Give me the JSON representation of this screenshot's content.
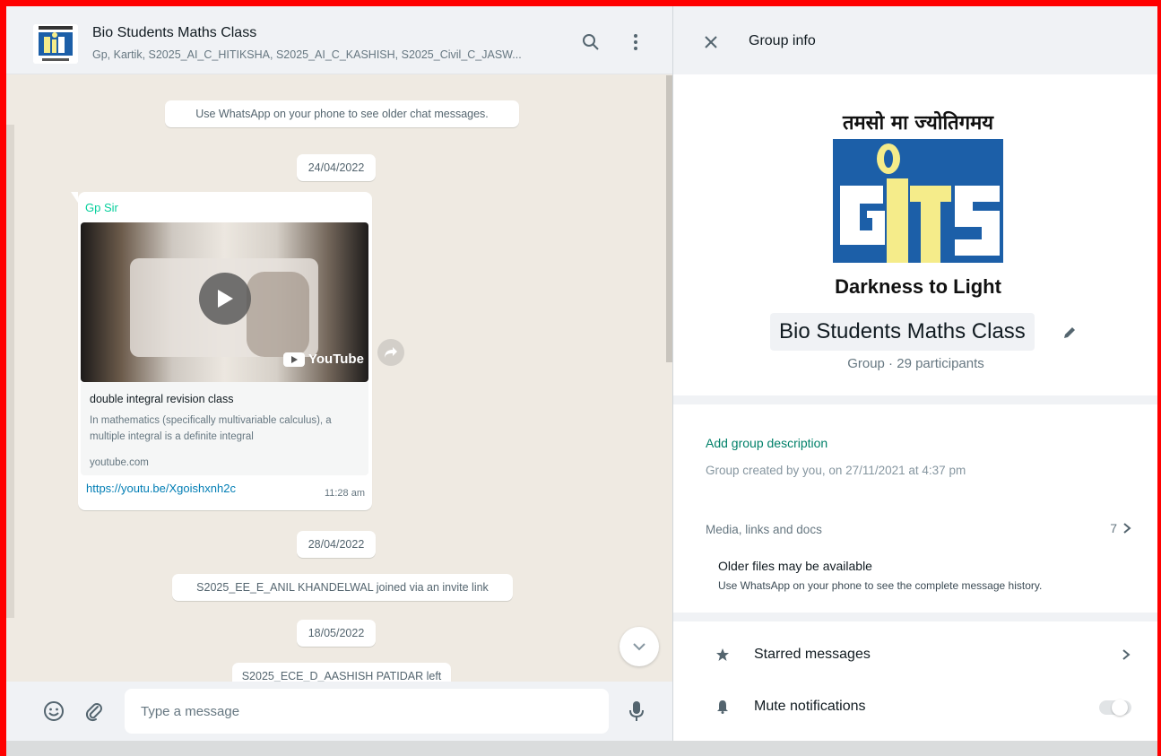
{
  "chat": {
    "title": "Bio Students Maths Class",
    "subtitle": "Gp, Kartik, S2025_AI_C_HITIKSHA, S2025_AI_C_KASHISH, S2025_Civil_C_JASW...",
    "older_notice": "Use WhatsApp on your phone to see older chat messages.",
    "date_1": "24/04/2022",
    "message": {
      "sender": "Gp Sir",
      "thumbnail_brand": "YouTube",
      "preview_title": "double integral revision class",
      "preview_description": "In mathematics (specifically multivariable calculus), a multiple integral is a definite integral",
      "preview_domain": "youtube.com",
      "link": "https://youtu.be/Xgoishxnh2c",
      "time": "11:28 am"
    },
    "date_2": "28/04/2022",
    "event_joined": "S2025_EE_E_ANIL KHANDELWAL joined via an invite link",
    "date_3": "18/05/2022",
    "event_left": "S2025_ECE_D_AASHISH PATIDAR left",
    "composer_placeholder": "Type a message"
  },
  "info": {
    "header_title": "Group info",
    "logo_top_text": "तमसो मा ज्योतिगमय",
    "logo_bottom_text": "Darkness to Light",
    "group_name": "Bio Students Maths Class",
    "group_meta": "Group · 29 participants",
    "add_description": "Add group description",
    "created_text": "Group created by you, on 27/11/2021 at 4:37 pm",
    "media_label": "Media, links and docs",
    "media_count": "7",
    "older_files_title": "Older files may be available",
    "older_files_sub": "Use WhatsApp on your phone to see the complete message history.",
    "starred_label": "Starred messages",
    "mute_label": "Mute notifications",
    "mute_enabled": false
  },
  "colors": {
    "accent_green": "#008069",
    "sender_green": "#06cf9c",
    "link_blue": "#027eb5",
    "frame_red": "#ff0000"
  }
}
